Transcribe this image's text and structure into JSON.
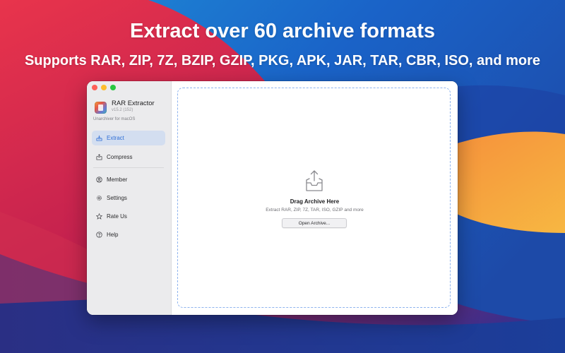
{
  "promo": {
    "headline": "Extract over 60 archive formats",
    "subheadline": "Supports RAR, ZIP, 7Z, BZIP, GZIP, PKG, APK, JAR, TAR, CBR, ISO, and more"
  },
  "app": {
    "name": "RAR Extractor",
    "version": "v15.2 (152)",
    "tagline": "Unarchiver for macOS"
  },
  "sidebar": {
    "items": [
      {
        "label": "Extract",
        "icon": "extract-tray-icon",
        "active": true
      },
      {
        "label": "Compress",
        "icon": "compress-box-icon",
        "active": false
      },
      {
        "label": "Member",
        "icon": "person-circle-icon",
        "active": false
      },
      {
        "label": "Settings",
        "icon": "gear-icon",
        "active": false
      },
      {
        "label": "Rate Us",
        "icon": "star-icon",
        "active": false
      },
      {
        "label": "Help",
        "icon": "question-circle-icon",
        "active": false
      }
    ]
  },
  "dropzone": {
    "icon": "tray-upload-icon",
    "title": "Drag Archive Here",
    "subtitle": "Extract RAR, ZIP, 7Z, TAR, ISO, GZIP and more",
    "button_label": "Open Archive..."
  },
  "colors": {
    "accent": "#2f6fd6",
    "active_item_bg": "#d3def0",
    "dashed_border": "#8eb3ee"
  }
}
